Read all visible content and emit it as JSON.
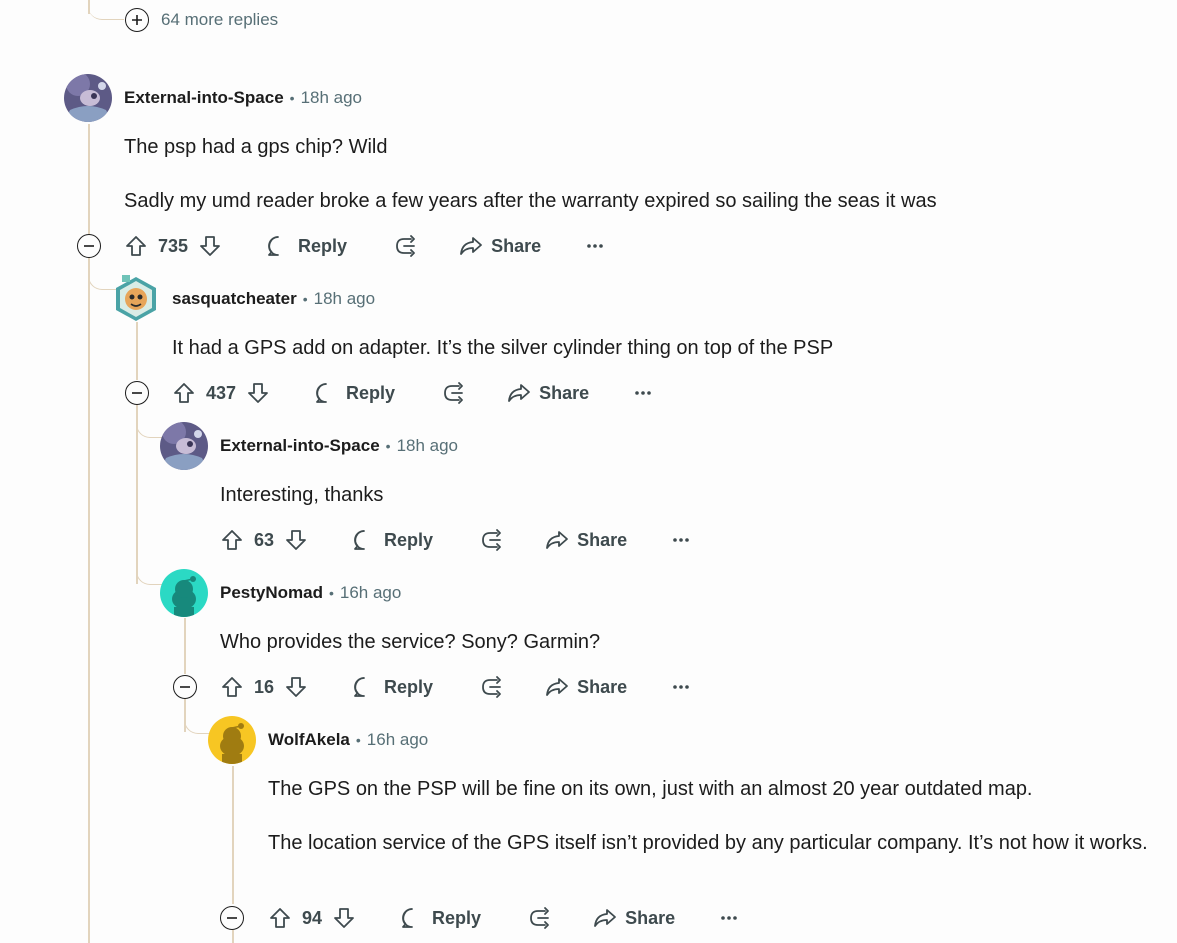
{
  "more_replies": {
    "label": "64 more replies"
  },
  "actions": {
    "reply": "Reply",
    "share": "Share"
  },
  "comments": [
    {
      "username": "External-into-Space",
      "sep": "•",
      "time": "18h ago",
      "body": [
        "The psp had a gps chip? Wild",
        "Sadly my umd reader broke a few years after the warranty expired so sailing the seas it was"
      ],
      "votes": "735"
    },
    {
      "username": "sasquatcheater",
      "sep": "•",
      "time": "18h ago",
      "body": [
        "It had a GPS add on adapter. It’s the silver cylinder thing on top of the PSP"
      ],
      "votes": "437"
    },
    {
      "username": "External-into-Space",
      "sep": "•",
      "time": "18h ago",
      "body": [
        "Interesting, thanks"
      ],
      "votes": "63"
    },
    {
      "username": "PestyNomad",
      "sep": "•",
      "time": "16h ago",
      "body": [
        "Who provides the service? Sony? Garmin?"
      ],
      "votes": "16"
    },
    {
      "username": "WolfAkela",
      "sep": "•",
      "time": "16h ago",
      "body": [
        "The GPS on the PSP will be fine on its own, just with an almost 20 year outdated map.",
        "The location service of the GPS itself isn’t provided by any particular company. It’s not how it works."
      ],
      "votes": "94"
    }
  ],
  "colors": {
    "thread_line": "#e2d4bd",
    "meta_text": "#576f76",
    "snoo_teal": "#2bd9c4",
    "snoo_yellow": "#f7c623"
  }
}
